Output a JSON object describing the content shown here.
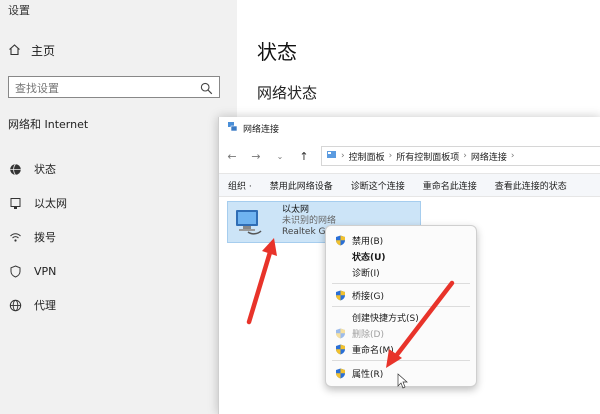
{
  "settings": {
    "window_title": "设置",
    "home_label": "主页",
    "search_placeholder": "查找设置",
    "section_title": "网络和 Internet",
    "nav": [
      {
        "label": "状态",
        "icon": "globe-icon"
      },
      {
        "label": "以太网",
        "icon": "ethernet-icon"
      },
      {
        "label": "拨号",
        "icon": "dialup-icon"
      },
      {
        "label": "VPN",
        "icon": "vpn-icon"
      },
      {
        "label": "代理",
        "icon": "proxy-globe-icon"
      }
    ],
    "main_title": "状态",
    "main_subtitle": "网络状态"
  },
  "netwin": {
    "title": "网络连接",
    "breadcrumb": [
      "控制面板",
      "所有控制面板项",
      "网络连接"
    ],
    "commands": [
      "组织 ·",
      "禁用此网络设备",
      "诊断这个连接",
      "重命名此连接",
      "查看此连接的状态"
    ],
    "adapter": {
      "name": "以太网",
      "status": "未识别的网络",
      "device": "Realtek Gam"
    }
  },
  "context_menu": {
    "items": [
      {
        "label": "禁用(B)",
        "shield": true,
        "bold": false,
        "disabled": false
      },
      {
        "label": "状态(U)",
        "shield": false,
        "bold": true,
        "disabled": false
      },
      {
        "label": "诊断(I)",
        "shield": false,
        "bold": false,
        "disabled": false
      },
      {
        "label": "桥接(G)",
        "shield": true,
        "bold": false,
        "disabled": false
      },
      {
        "label": "创建快捷方式(S)",
        "shield": false,
        "bold": false,
        "disabled": false
      },
      {
        "label": "删除(D)",
        "shield": true,
        "bold": false,
        "disabled": true
      },
      {
        "label": "重命名(M)",
        "shield": true,
        "bold": false,
        "disabled": false
      },
      {
        "label": "属性(R)",
        "shield": true,
        "bold": false,
        "disabled": false
      }
    ]
  },
  "colors": {
    "annotation_arrow": "#e8332a",
    "selection": "#cce4f7",
    "shield_blue": "#2a6fd6",
    "shield_yellow": "#f2c12e"
  }
}
